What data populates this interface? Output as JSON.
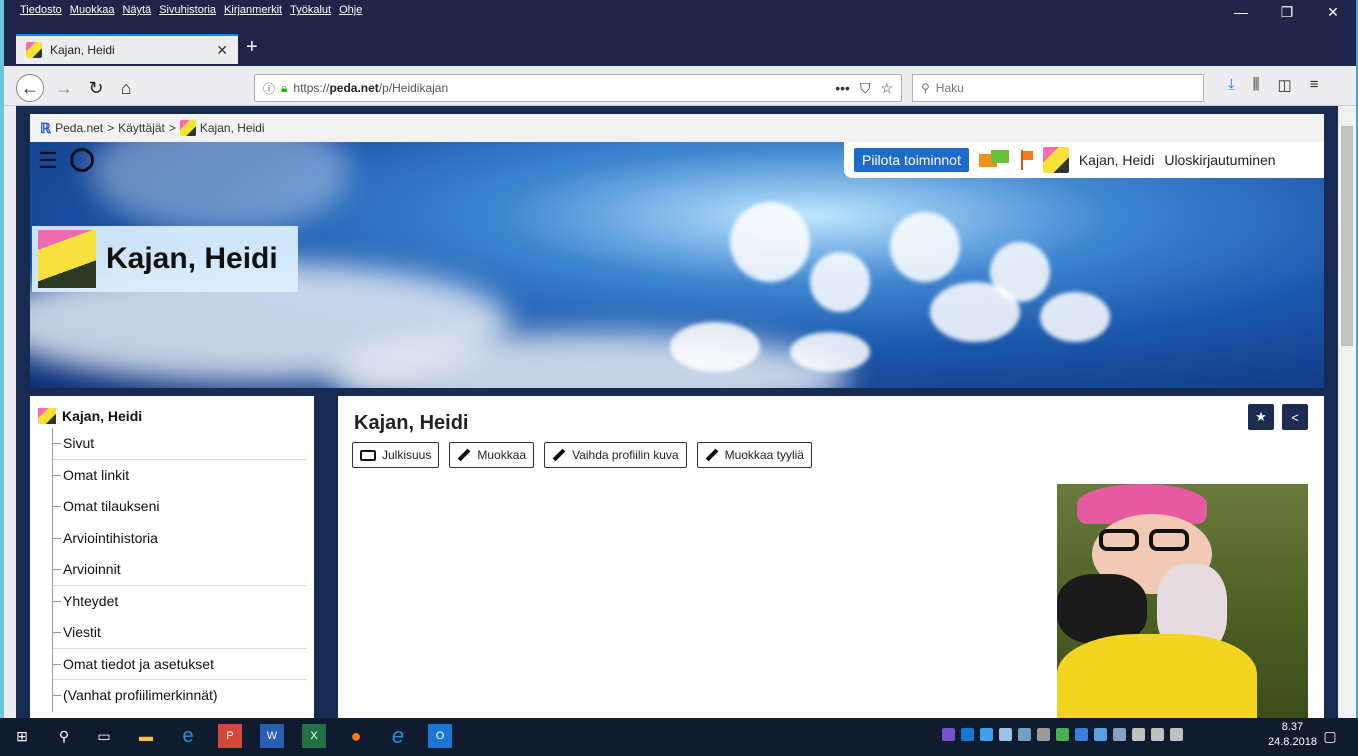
{
  "browser": {
    "menu": [
      "Tiedosto",
      "Muokkaa",
      "Näytä",
      "Sivuhistoria",
      "Kirjanmerkit",
      "Työkalut",
      "Ohje"
    ],
    "tab_title": "Kajan, Heidi",
    "url_prefix": "https://",
    "url_domain": "peda.net",
    "url_path": "/p/Heidikajan",
    "url_more": "•••",
    "search_placeholder": "Haku"
  },
  "page": {
    "breadcrumb": {
      "site": "Peda.net",
      "sep1": ">",
      "users": "Käyttäjät",
      "sep2": ">",
      "current": "Kajan, Heidi"
    },
    "actionbar": {
      "hide_label": "Piilota toiminnot",
      "user_name": "Kajan, Heidi",
      "logout_label": "Uloskirjautuminen"
    },
    "banner_name": "Kajan, Heidi",
    "sidebar": {
      "title": "Kajan, Heidi",
      "items": [
        "Sivut",
        "Omat linkit",
        "Omat tilaukseni",
        "Arviointihistoria",
        "Arvioinnit",
        "Yhteydet",
        "Viestit",
        "Omat tiedot ja asetukset",
        "(Vanhat profiilimerkinnät)"
      ]
    },
    "main": {
      "title": "Kajan, Heidi",
      "buttons": {
        "publicity": "Julkisuus",
        "edit": "Muokkaa",
        "change_photo": "Vaihda profiilin kuva",
        "edit_style": "Muokkaa tyyliä"
      }
    }
  },
  "taskbar": {
    "time": "8.37",
    "date": "24.8.2018"
  }
}
